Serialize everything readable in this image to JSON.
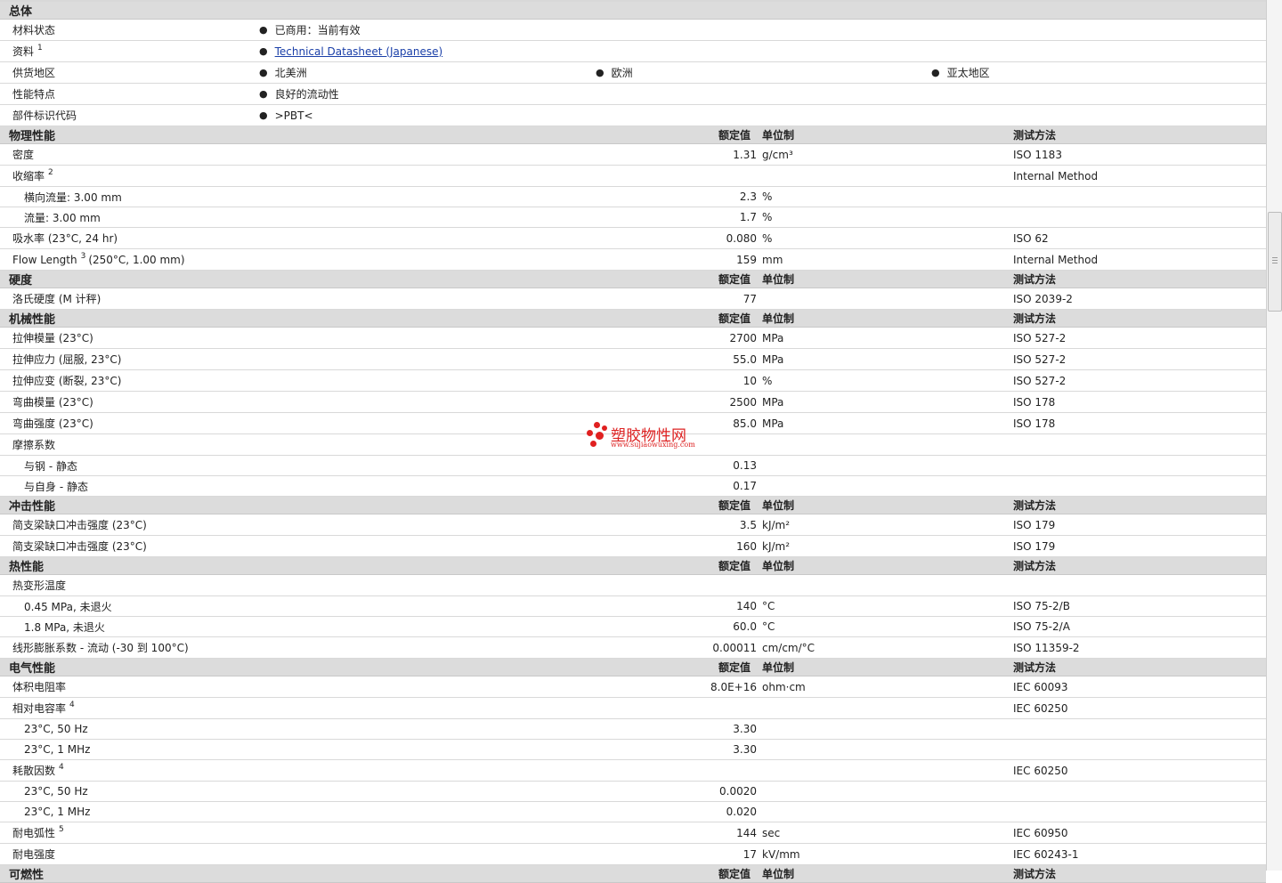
{
  "sections": [
    {
      "title": "总体",
      "general": true,
      "rows": [
        {
          "name": "材料状态",
          "bullets": [
            "已商用：当前有效"
          ]
        },
        {
          "name": "资料",
          "sup": "1",
          "bullets": [
            "Technical Datasheet (Japanese)"
          ],
          "link": true
        },
        {
          "name": "供货地区",
          "bullets": [
            "北美洲",
            "欧洲",
            "亚太地区"
          ]
        },
        {
          "name": "性能特点",
          "bullets": [
            "良好的流动性"
          ]
        },
        {
          "name": "部件标识代码",
          "bullets": [
            ">PBT<"
          ]
        }
      ]
    },
    {
      "title": "物理性能",
      "headers": {
        "value": "额定值",
        "unit": "单位制",
        "method": "测试方法"
      },
      "rows": [
        {
          "name": "密度",
          "value": "1.31",
          "unit": "g/cm³",
          "method": "ISO 1183"
        },
        {
          "name": "收缩率",
          "sup": "2",
          "value": "",
          "unit": "",
          "method": "Internal Method"
        },
        {
          "name": "横向流量: 3.00 mm",
          "indent": true,
          "value": "2.3",
          "unit": "%",
          "method": ""
        },
        {
          "name": "流量: 3.00 mm",
          "indent": true,
          "value": "1.7",
          "unit": "%",
          "method": ""
        },
        {
          "name": "吸水率 (23°C, 24 hr)",
          "value": "0.080",
          "unit": "%",
          "method": "ISO 62"
        },
        {
          "name": "Flow Length",
          "sup": "3",
          "suffix": "(250°C, 1.00 mm)",
          "value": "159",
          "unit": "mm",
          "method": "Internal Method"
        }
      ]
    },
    {
      "title": "硬度",
      "headers": {
        "value": "额定值",
        "unit": "单位制",
        "method": "测试方法"
      },
      "rows": [
        {
          "name": "洛氏硬度 (M 计秤)",
          "value": "77",
          "unit": "",
          "method": "ISO 2039-2"
        }
      ]
    },
    {
      "title": "机械性能",
      "headers": {
        "value": "额定值",
        "unit": "单位制",
        "method": "测试方法"
      },
      "rows": [
        {
          "name": "拉伸模量 (23°C)",
          "value": "2700",
          "unit": "MPa",
          "method": "ISO 527-2"
        },
        {
          "name": "拉伸应力 (屈服, 23°C)",
          "value": "55.0",
          "unit": "MPa",
          "method": "ISO 527-2"
        },
        {
          "name": "拉伸应变 (断裂, 23°C)",
          "value": "10",
          "unit": "%",
          "method": "ISO 527-2"
        },
        {
          "name": "弯曲模量 (23°C)",
          "value": "2500",
          "unit": "MPa",
          "method": "ISO 178"
        },
        {
          "name": "弯曲强度 (23°C)",
          "value": "85.0",
          "unit": "MPa",
          "method": "ISO 178"
        },
        {
          "name": "摩擦系数",
          "value": "",
          "unit": "",
          "method": ""
        },
        {
          "name": "与钢 - 静态",
          "indent": true,
          "value": "0.13",
          "unit": "",
          "method": ""
        },
        {
          "name": "与自身 - 静态",
          "indent": true,
          "value": "0.17",
          "unit": "",
          "method": ""
        }
      ]
    },
    {
      "title": "冲击性能",
      "headers": {
        "value": "额定值",
        "unit": "单位制",
        "method": "测试方法"
      },
      "rows": [
        {
          "name": "简支梁缺口冲击强度 (23°C)",
          "value": "3.5",
          "unit": "kJ/m²",
          "method": "ISO 179"
        },
        {
          "name": "简支梁缺口冲击强度 (23°C)",
          "value": "160",
          "unit": "kJ/m²",
          "method": "ISO 179"
        }
      ]
    },
    {
      "title": "热性能",
      "headers": {
        "value": "额定值",
        "unit": "单位制",
        "method": "测试方法"
      },
      "rows": [
        {
          "name": "热变形温度",
          "value": "",
          "unit": "",
          "method": ""
        },
        {
          "name": "0.45 MPa, 未退火",
          "indent": true,
          "value": "140",
          "unit": "°C",
          "method": "ISO 75-2/B"
        },
        {
          "name": "1.8 MPa, 未退火",
          "indent": true,
          "value": "60.0",
          "unit": "°C",
          "method": "ISO 75-2/A"
        },
        {
          "name": "线形膨胀系数 - 流动 (-30 到 100°C)",
          "value": "0.00011",
          "unit": "cm/cm/°C",
          "method": "ISO 11359-2"
        }
      ]
    },
    {
      "title": "电气性能",
      "headers": {
        "value": "额定值",
        "unit": "单位制",
        "method": "测试方法"
      },
      "rows": [
        {
          "name": "体积电阻率",
          "value": "8.0E+16",
          "unit": "ohm·cm",
          "method": "IEC 60093"
        },
        {
          "name": "相对电容率",
          "sup": "4",
          "value": "",
          "unit": "",
          "method": "IEC 60250"
        },
        {
          "name": "23°C, 50 Hz",
          "indent": true,
          "value": "3.30",
          "unit": "",
          "method": ""
        },
        {
          "name": "23°C, 1 MHz",
          "indent": true,
          "value": "3.30",
          "unit": "",
          "method": ""
        },
        {
          "name": "耗散因数",
          "sup": "4",
          "value": "",
          "unit": "",
          "method": "IEC 60250"
        },
        {
          "name": "23°C, 50 Hz",
          "indent": true,
          "value": "0.0020",
          "unit": "",
          "method": ""
        },
        {
          "name": "23°C, 1 MHz",
          "indent": true,
          "value": "0.020",
          "unit": "",
          "method": ""
        },
        {
          "name": "耐电弧性",
          "sup": "5",
          "value": "144",
          "unit": "sec",
          "method": "IEC 60950"
        },
        {
          "name": "耐电强度",
          "value": "17",
          "unit": "kV/mm",
          "method": "IEC 60243-1"
        }
      ]
    },
    {
      "title": "可燃性",
      "headers": {
        "value": "额定值",
        "unit": "单位制",
        "method": "测试方法"
      },
      "rows": []
    }
  ],
  "watermark": {
    "title": "塑胶物性网",
    "url": "www.sujiaowuxing.com"
  },
  "colors": {
    "section_bg": "#dcdcdc",
    "link": "#1a3fa8",
    "watermark": "#e02020"
  }
}
